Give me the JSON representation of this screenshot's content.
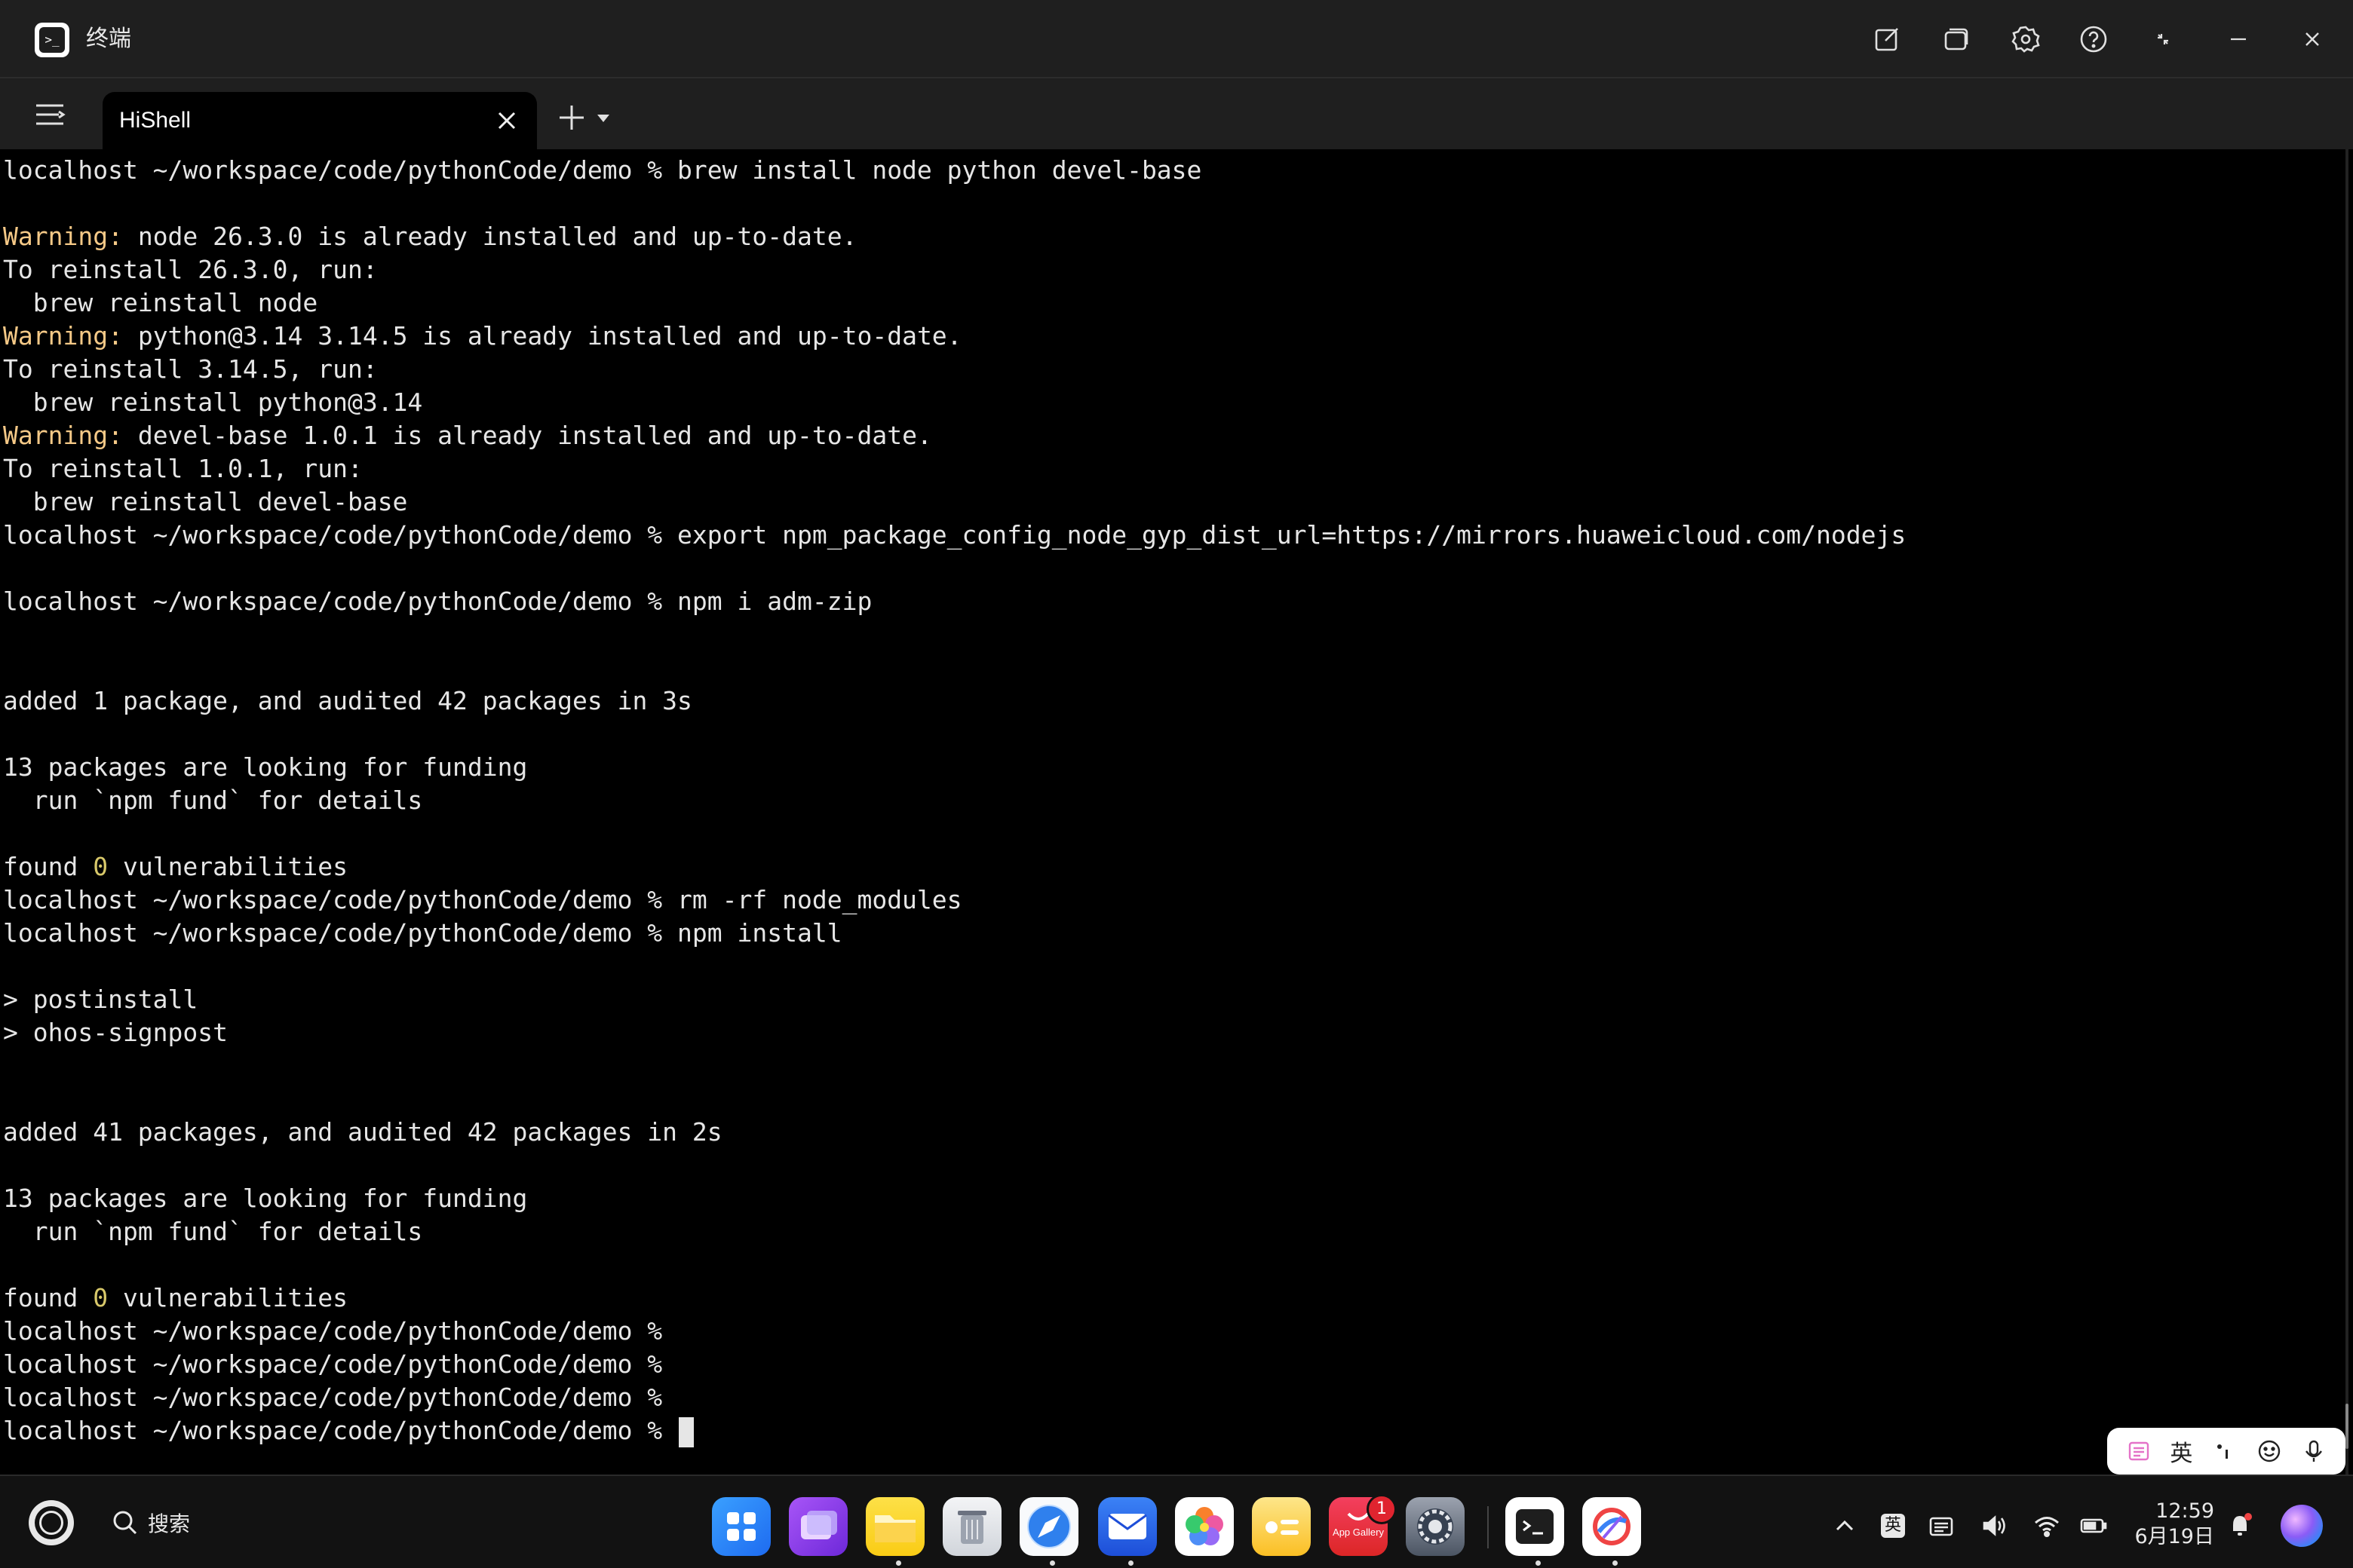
{
  "window": {
    "title": "终端"
  },
  "tab": {
    "label": "HiShell"
  },
  "terminal": {
    "lines": [
      {
        "text": "localhost ~/workspace/code/pythonCode/demo % brew install node python devel-base"
      },
      {
        "text": ""
      },
      {
        "prefix": "Warning:",
        "text": " node 26.3.0 is already installed and up-to-date."
      },
      {
        "text": "To reinstall 26.3.0, run:"
      },
      {
        "text": "  brew reinstall node"
      },
      {
        "prefix": "Warning:",
        "text": " python@3.14 3.14.5 is already installed and up-to-date."
      },
      {
        "text": "To reinstall 3.14.5, run:"
      },
      {
        "text": "  brew reinstall python@3.14"
      },
      {
        "prefix": "Warning:",
        "text": " devel-base 1.0.1 is already installed and up-to-date."
      },
      {
        "text": "To reinstall 1.0.1, run:"
      },
      {
        "text": "  brew reinstall devel-base"
      },
      {
        "text": "localhost ~/workspace/code/pythonCode/demo % export npm_package_config_node_gyp_dist_url=https://mirrors.huaweicloud.com/nodejs"
      },
      {
        "text": ""
      },
      {
        "text": "localhost ~/workspace/code/pythonCode/demo % npm i adm-zip"
      },
      {
        "text": ""
      },
      {
        "text": ""
      },
      {
        "text": "added 1 package, and audited 42 packages in 3s"
      },
      {
        "text": ""
      },
      {
        "text": "13 packages are looking for funding"
      },
      {
        "text": "  run `npm fund` for details"
      },
      {
        "text": ""
      },
      {
        "text": "found ",
        "num": "0",
        "suffix": " vulnerabilities"
      },
      {
        "text": "localhost ~/workspace/code/pythonCode/demo % rm -rf node_modules"
      },
      {
        "text": "localhost ~/workspace/code/pythonCode/demo % npm install"
      },
      {
        "text": ""
      },
      {
        "text": "> postinstall"
      },
      {
        "text": "> ohos-signpost"
      },
      {
        "text": ""
      },
      {
        "text": ""
      },
      {
        "text": "added 41 packages, and audited 42 packages in 2s"
      },
      {
        "text": ""
      },
      {
        "text": "13 packages are looking for funding"
      },
      {
        "text": "  run `npm fund` for details"
      },
      {
        "text": ""
      },
      {
        "text": "found ",
        "num": "0",
        "suffix": " vulnerabilities"
      },
      {
        "text": "localhost ~/workspace/code/pythonCode/demo %"
      },
      {
        "text": "localhost ~/workspace/code/pythonCode/demo %"
      },
      {
        "text": "localhost ~/workspace/code/pythonCode/demo %"
      },
      {
        "text": "localhost ~/workspace/code/pythonCode/demo % ",
        "cursor": true
      }
    ],
    "colors": {
      "warning": "#f5c987",
      "number": "#d8c86a",
      "text": "#e6e6e6"
    }
  },
  "ime": {
    "lang_label": "英"
  },
  "taskbar": {
    "search_label": "搜索",
    "dock_apps": [
      "home-screen",
      "multitask",
      "files",
      "trash",
      "browser",
      "mail",
      "gallery",
      "notepad",
      "app-gallery",
      "settings",
      "terminal",
      "devtools"
    ],
    "app_gallery_text": "App Gallery",
    "app_gallery_badge": "1",
    "tray_lang": "英",
    "time": "12:59",
    "date": "6月19日"
  }
}
